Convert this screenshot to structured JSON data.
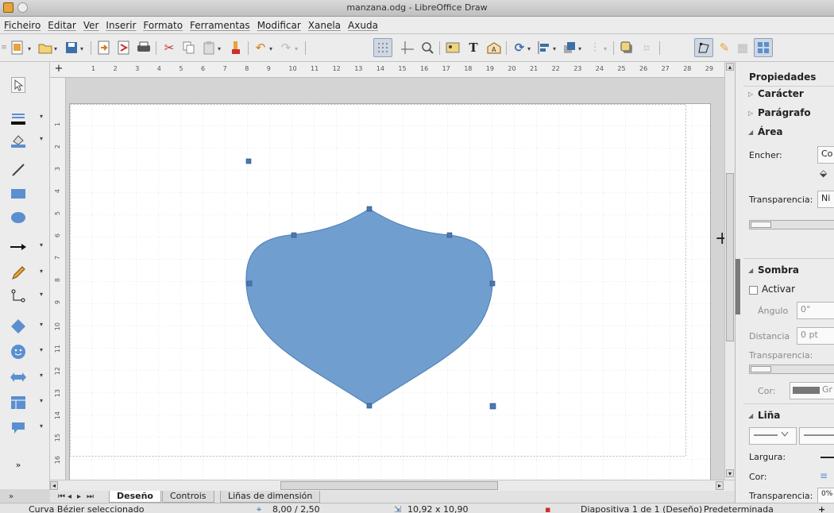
{
  "window": {
    "title": "manzana.odg - LibreOffice Draw"
  },
  "menu": [
    "Ficheiro",
    "Editar",
    "Ver",
    "Inserir",
    "Formato",
    "Ferramentas",
    "Modificar",
    "Xanela",
    "Axuda"
  ],
  "toolbar_icons": [
    "new-document-icon",
    "open-folder-icon",
    "save-icon",
    "export-icon",
    "export-pdf-icon",
    "print-icon",
    "cut-icon",
    "copy-icon",
    "paste-icon",
    "clone-formatting-icon",
    "undo-icon",
    "redo-icon",
    "grid-icon",
    "helplines-icon",
    "zoom-icon",
    "insert-image-icon",
    "text-box-icon",
    "fontwork-icon",
    "rotate-icon",
    "align-icon",
    "arrange-icon",
    "distribute-icon",
    "shadow-icon",
    "crop-icon",
    "points-icon",
    "glue-points-icon",
    "toggle-extrusion-icon",
    "display-views-icon"
  ],
  "left_tools": [
    "select-arrow-icon",
    "line-color-icon",
    "fill-color-icon",
    "line-tool-icon",
    "rectangle-tool-icon",
    "ellipse-tool-icon",
    "arrow-line-icon",
    "curve-pencil-icon",
    "connector-icon",
    "basic-shapes-diamond-icon",
    "symbol-shapes-smiley-icon",
    "block-arrows-icon",
    "flowchart-icon",
    "callout-icon",
    "more-tools-chevron-icon"
  ],
  "ruler_h": [
    "1",
    "2",
    "3",
    "4",
    "5",
    "6",
    "7",
    "8",
    "9",
    "10",
    "11",
    "12",
    "13",
    "14",
    "15",
    "16",
    "17",
    "18",
    "19",
    "20",
    "21",
    "22",
    "23",
    "24",
    "25",
    "26",
    "27",
    "28",
    "29"
  ],
  "ruler_v": [
    "1",
    "2",
    "3",
    "4",
    "5",
    "6",
    "7",
    "8",
    "9",
    "10",
    "11",
    "12",
    "13",
    "14",
    "15",
    "16"
  ],
  "tabs": [
    "Deseño",
    "Controis",
    "Liñas de dimensión"
  ],
  "active_tab": "Deseño",
  "status": {
    "selection": "Curva Bézier seleccionado",
    "position": "8,00 / 2,50",
    "size": "10,92 x 10,90",
    "slide": "Diapositiva 1 de 1 (Deseño)",
    "master": "Predeterminada",
    "zoom_plus": "+"
  },
  "sidebar": {
    "title": "Propiedades",
    "caracter": "Carácter",
    "paragrafo": "Parágrafo",
    "area": "Área",
    "encher_label": "Encher:",
    "encher_value": "Co",
    "transparencia_label": "Transparencia:",
    "transparencia_value": "Ni",
    "sombra": "Sombra",
    "activar": "Activar",
    "angulo_label": "Ángulo",
    "angulo_value": "0°",
    "distancia_label": "Distancia",
    "distancia_value": "0 pt",
    "sombra_transp_label": "Transparencia:",
    "cor_label": "Cor:",
    "cor_value": "Gr",
    "linha": "Liña",
    "largura_label": "Largura:",
    "cor2_label": "Cor:",
    "transp3_label": "Transparencia:",
    "transp3_value": "0%"
  },
  "colors": {
    "shape_fill": "#6f9ecf",
    "shape_stroke": "#4f7fb5",
    "handle": "#4a78b4"
  }
}
